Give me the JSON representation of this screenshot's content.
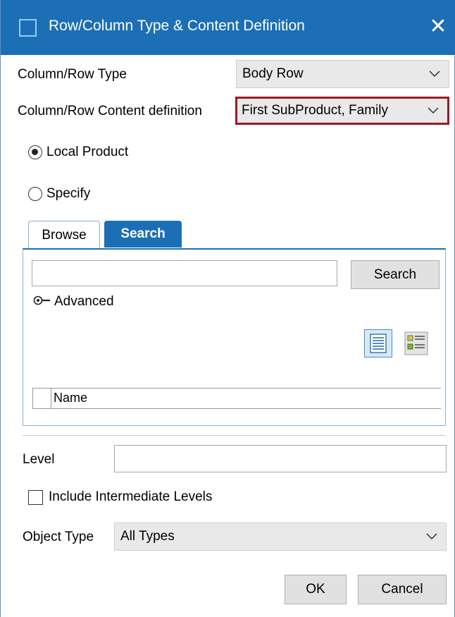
{
  "window": {
    "title": "Row/Column Type & Content Definition",
    "close_glyph": "✕"
  },
  "fields": {
    "type_label": "Column/Row Type",
    "type_value": "Body Row",
    "content_label": "Column/Row Content definition",
    "content_value": "First SubProduct, Family"
  },
  "radios": {
    "local_product": {
      "label": "Local Product",
      "checked": true
    },
    "specify": {
      "label": "Specify",
      "checked": false
    }
  },
  "tabs": {
    "browse": "Browse",
    "search": "Search",
    "active": "Search"
  },
  "search_panel": {
    "query_value": "",
    "search_button": "Search",
    "advanced_label": "Advanced",
    "column_header": "Name",
    "view_buttons": [
      "list-view-icon",
      "detail-view-icon"
    ]
  },
  "level": {
    "label": "Level",
    "value": ""
  },
  "include_intermediate": {
    "label": "Include Intermediate Levels",
    "checked": false
  },
  "object_type": {
    "label": "Object Type",
    "value": "All Types"
  },
  "buttons": {
    "ok": "OK",
    "cancel": "Cancel"
  },
  "colors": {
    "titlebar": "#1c6fb5",
    "highlight_border": "#9b1b25",
    "active_tab": "#1c6fb5"
  }
}
